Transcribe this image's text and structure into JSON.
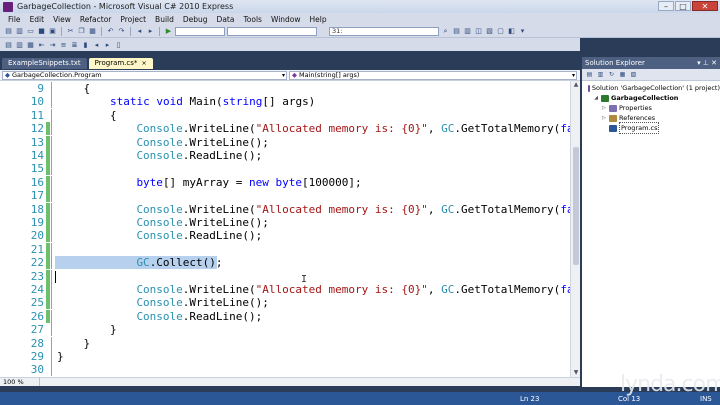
{
  "window": {
    "title": "GarbageCollection - Microsoft Visual C# 2010 Express",
    "minimize": "–",
    "maximize": "□",
    "close": "✕"
  },
  "menu": [
    "File",
    "Edit",
    "View",
    "Refactor",
    "Project",
    "Build",
    "Debug",
    "Data",
    "Tools",
    "Window",
    "Help"
  ],
  "toolbar": {
    "line_combo": "31:",
    "config_combo": ""
  },
  "tabs": [
    {
      "label": "ExampleSnippets.txt",
      "active": false
    },
    {
      "label": "Program.cs*",
      "active": true,
      "close": "×"
    }
  ],
  "navbar": {
    "type_combo": "GarbageCollection.Program",
    "member_combo": "Main(string[] args)"
  },
  "editor": {
    "lines": [
      {
        "n": "9",
        "text": "{",
        "indent": 4
      },
      {
        "n": "10",
        "indent": 8,
        "tokens": [
          [
            "kw",
            "static"
          ],
          [
            "",
            " "
          ],
          [
            "kw",
            "void"
          ],
          [
            "",
            " Main("
          ],
          [
            "kw",
            "string"
          ],
          [
            "",
            "[] args)"
          ]
        ]
      },
      {
        "n": "11",
        "text": "{",
        "indent": 8
      },
      {
        "n": "12",
        "indent": 12,
        "tokens": [
          [
            "ty",
            "Console"
          ],
          [
            "",
            ".WriteLine("
          ],
          [
            "str",
            "\"Allocated memory is: {0}\""
          ],
          [
            "",
            ", "
          ],
          [
            "ty",
            "GC"
          ],
          [
            "",
            ".GetTotalMemory("
          ],
          [
            "kw",
            "false"
          ],
          [
            "",
            "))"
          ]
        ]
      },
      {
        "n": "13",
        "indent": 12,
        "tokens": [
          [
            "ty",
            "Console"
          ],
          [
            "",
            ".WriteLine();"
          ]
        ]
      },
      {
        "n": "14",
        "indent": 12,
        "tokens": [
          [
            "ty",
            "Console"
          ],
          [
            "",
            ".ReadLine();"
          ]
        ]
      },
      {
        "n": "15",
        "text": "",
        "indent": 0
      },
      {
        "n": "16",
        "indent": 12,
        "tokens": [
          [
            "kw",
            "byte"
          ],
          [
            "",
            "[] myArray = "
          ],
          [
            "kw",
            "new"
          ],
          [
            "",
            " "
          ],
          [
            "kw",
            "byte"
          ],
          [
            "",
            "[100000];"
          ]
        ]
      },
      {
        "n": "17",
        "text": "",
        "indent": 0
      },
      {
        "n": "18",
        "indent": 12,
        "tokens": [
          [
            "ty",
            "Console"
          ],
          [
            "",
            ".WriteLine("
          ],
          [
            "str",
            "\"Allocated memory is: {0}\""
          ],
          [
            "",
            ", "
          ],
          [
            "ty",
            "GC"
          ],
          [
            "",
            ".GetTotalMemory("
          ],
          [
            "kw",
            "false"
          ],
          [
            "",
            "))"
          ]
        ]
      },
      {
        "n": "19",
        "indent": 12,
        "tokens": [
          [
            "ty",
            "Console"
          ],
          [
            "",
            ".WriteLine();"
          ]
        ]
      },
      {
        "n": "20",
        "indent": 12,
        "tokens": [
          [
            "ty",
            "Console"
          ],
          [
            "",
            ".ReadLine();"
          ]
        ]
      },
      {
        "n": "21",
        "text": "",
        "indent": 0
      },
      {
        "n": "22",
        "indent": 12,
        "selected": true,
        "tokens": [
          [
            "ty",
            "GC"
          ],
          [
            "",
            ".Collect();"
          ]
        ]
      },
      {
        "n": "23",
        "text": "",
        "indent": 0
      },
      {
        "n": "24",
        "indent": 12,
        "tokens": [
          [
            "ty",
            "Console"
          ],
          [
            "",
            ".WriteLine("
          ],
          [
            "str",
            "\"Allocated memory is: {0}\""
          ],
          [
            "",
            ", "
          ],
          [
            "ty",
            "GC"
          ],
          [
            "",
            ".GetTotalMemory("
          ],
          [
            "kw",
            "false"
          ],
          [
            "",
            "))"
          ]
        ]
      },
      {
        "n": "25",
        "indent": 12,
        "tokens": [
          [
            "ty",
            "Console"
          ],
          [
            "",
            ".WriteLine();"
          ]
        ]
      },
      {
        "n": "26",
        "indent": 12,
        "tokens": [
          [
            "ty",
            "Console"
          ],
          [
            "",
            ".ReadLine();"
          ]
        ]
      },
      {
        "n": "27",
        "text": "}",
        "indent": 8
      },
      {
        "n": "28",
        "text": "}",
        "indent": 4
      },
      {
        "n": "29",
        "text": "}",
        "indent": 0
      },
      {
        "n": "30",
        "text": "",
        "indent": 0
      }
    ],
    "zoom": "100 %"
  },
  "solution_explorer": {
    "title": "Solution Explorer",
    "pin": "▾ ⊥ ✕",
    "items": [
      {
        "label": "Solution 'GarbageCollection' (1 project)",
        "level": 0,
        "twisty": "",
        "color": "#6c4f9e"
      },
      {
        "label": "GarbageCollection",
        "level": 1,
        "twisty": "◢",
        "color": "#2d7a2d",
        "bold": true
      },
      {
        "label": "Properties",
        "level": 2,
        "twisty": "▷",
        "color": "#7d6fb0"
      },
      {
        "label": "References",
        "level": 2,
        "twisty": "▷",
        "color": "#b08a3e"
      },
      {
        "label": "Program.cs",
        "level": 2,
        "twisty": "",
        "color": "#2b5797"
      }
    ]
  },
  "statusbar": {
    "ln": "Ln 23",
    "col": "Col 13",
    "ins": "INS"
  },
  "watermark": "lynda.com"
}
